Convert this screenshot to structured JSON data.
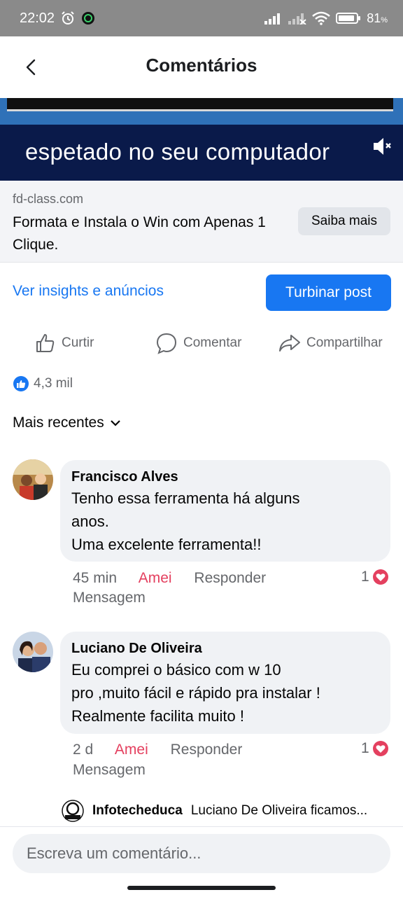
{
  "status_bar": {
    "time": "22:02",
    "battery": "81",
    "battery_unit": "%"
  },
  "header": {
    "title": "Comentários"
  },
  "ad": {
    "video_caption": "espetado no seu computador",
    "domain": "fd-class.com",
    "headline": "Formata e Instala o Win com Apenas 1 Clique.",
    "cta_label": "Saiba mais"
  },
  "post_tools": {
    "insights_label": "Ver insights e anúncios",
    "boost_label": "Turbinar post"
  },
  "actions": {
    "like": "Curtir",
    "comment": "Comentar",
    "share": "Compartilhar"
  },
  "reactions": {
    "count": "4,3 mil"
  },
  "sort": {
    "label": "Mais recentes"
  },
  "comments": [
    {
      "author": "Francisco Alves",
      "text": "Tenho essa ferramenta há alguns\nanos.\nUma excelente ferramenta!!",
      "time": "45 min",
      "reaction_label": "Amei",
      "reply_label": "Responder",
      "message_label": "Mensagem",
      "reaction_count": "1"
    },
    {
      "author": "Luciano De Oliveira",
      "text": "Eu comprei o básico com w 10\npro ,muito fácil e rápido pra instalar !\nRealmente facilita muito !",
      "time": "2 d",
      "reaction_label": "Amei",
      "reply_label": "Responder",
      "message_label": "Mensagem",
      "reaction_count": "1"
    }
  ],
  "reply_preview": {
    "author": "Infotecheduca",
    "text": "Luciano De Oliveira ficamos..."
  },
  "composer": {
    "placeholder": "Escreva um comentário..."
  },
  "colors": {
    "brand_blue": "#1877f2",
    "love_red": "#e4405f",
    "bubble_bg": "#f0f2f5",
    "meta_gray": "#65676b"
  }
}
